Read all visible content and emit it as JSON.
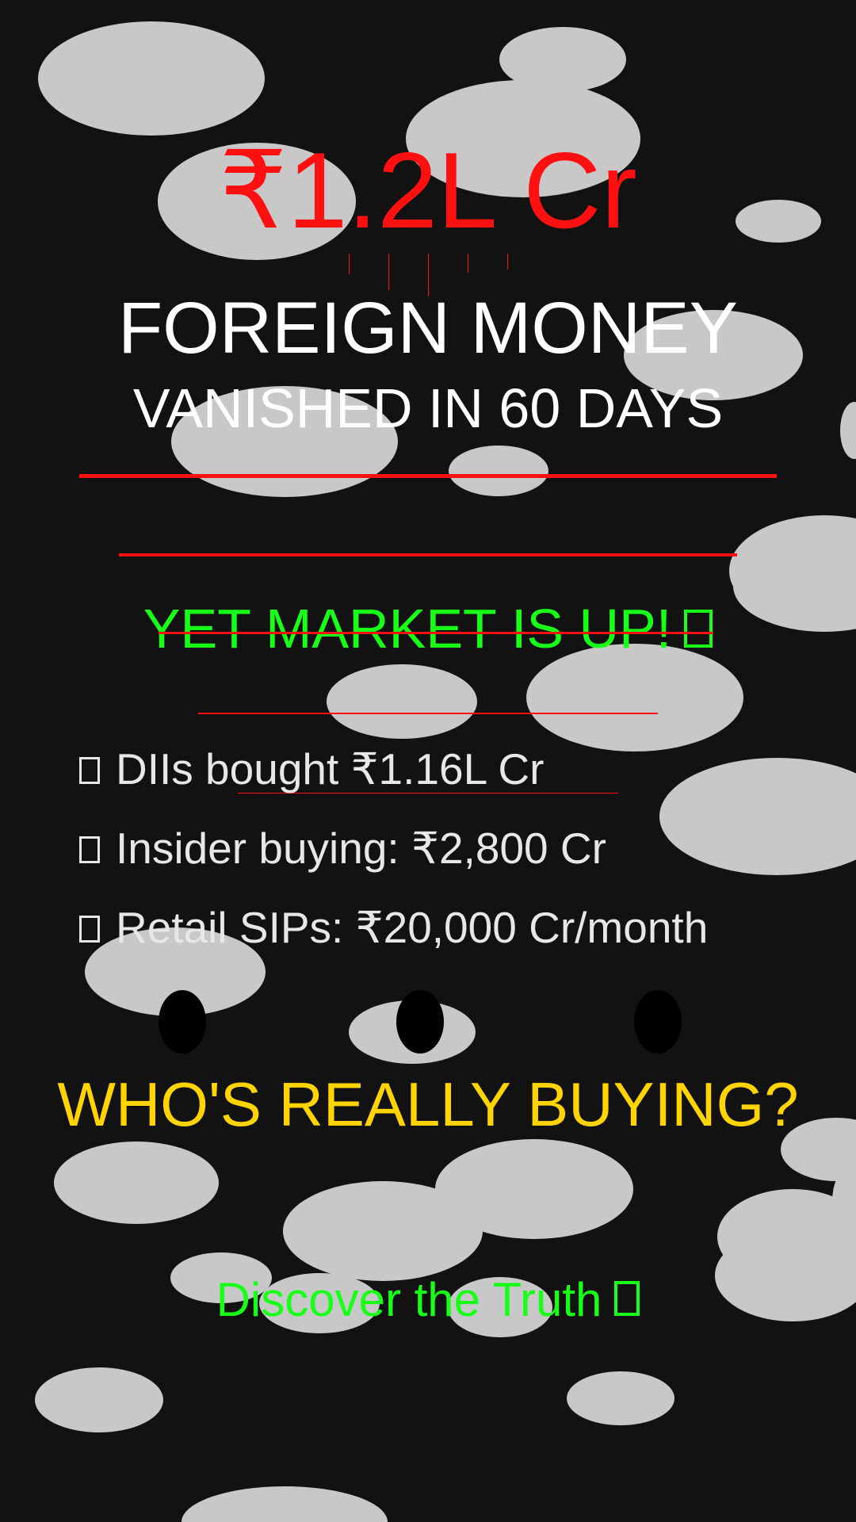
{
  "colors": {
    "background": "#121212",
    "blob": "#c8c8c8",
    "accent_red": "#ff1010",
    "accent_green": "#18ff18",
    "accent_yellow": "#ffd400",
    "text_white": "#ffffff",
    "text_light": "#e7e7e7"
  },
  "headline": {
    "amount": "₹1.2L Cr",
    "title": "FOREIGN MONEY",
    "subtitle": "VANISHED IN 60 DAYS"
  },
  "market": {
    "text": "YET MARKET IS UP!"
  },
  "stats": [
    {
      "text": "DIIs bought ₹1.16L Cr"
    },
    {
      "text": "Insider buying: ₹2,800 Cr"
    },
    {
      "text": "Retail SIPs: ₹20,000 Cr/month"
    }
  ],
  "question": {
    "text": "WHO'S REALLY BUYING?"
  },
  "cta": {
    "text": "Discover the Truth"
  },
  "icons": {
    "bullet": "box-icon",
    "market_emoji": "box-icon",
    "cta_emoji": "box-icon"
  }
}
